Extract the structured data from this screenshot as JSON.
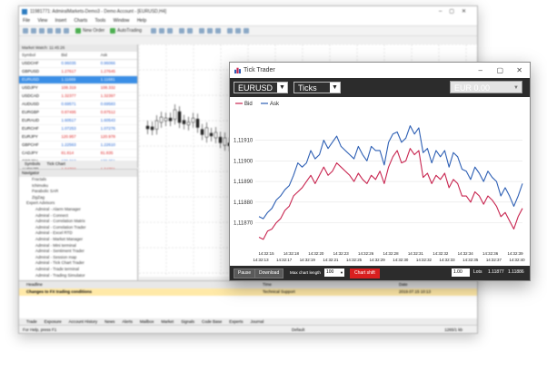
{
  "bg_window": {
    "title": "11981771: AdmiralMarkets-Demo3 - Demo Account - [EURUSD,H4]",
    "menu": [
      "File",
      "View",
      "Insert",
      "Charts",
      "Tools",
      "Window",
      "Help"
    ],
    "toolbar": {
      "new_order": "New Order",
      "auto_trading": "AutoTrading"
    },
    "market_watch": {
      "header": "Market Watch: 11:45:26",
      "columns": [
        "Symbol",
        "Bid",
        "Ask"
      ],
      "rows": [
        {
          "symbol": "USDCHF",
          "bid": "0.96035",
          "ask": "0.96066",
          "dir": "up"
        },
        {
          "symbol": "GBPUSD",
          "bid": "1.27617",
          "ask": "1.27645",
          "dir": "dn"
        },
        {
          "symbol": "EURUSD",
          "bid": "1.11669",
          "ask": "1.11681",
          "dir": "sel"
        },
        {
          "symbol": "USDJPY",
          "bid": "108.319",
          "ask": "108.332",
          "dir": "dn"
        },
        {
          "symbol": "USDCAD",
          "bid": "1.32377",
          "ask": "1.32397",
          "dir": "dn"
        },
        {
          "symbol": "AUDUSD",
          "bid": "0.69571",
          "ask": "0.69583",
          "dir": "up"
        },
        {
          "symbol": "EURGBP",
          "bid": "0.87495",
          "ask": "0.87512",
          "dir": "dn"
        },
        {
          "symbol": "EURAUD",
          "bid": "1.60517",
          "ask": "1.60543",
          "dir": "up"
        },
        {
          "symbol": "EURCHF",
          "bid": "1.07253",
          "ask": "1.07276",
          "dir": "up"
        },
        {
          "symbol": "EURJPY",
          "bid": "120.957",
          "ask": "120.978",
          "dir": "dn"
        },
        {
          "symbol": "GBPCHF",
          "bid": "1.22563",
          "ask": "1.22610",
          "dir": "up"
        },
        {
          "symbol": "CADJPY",
          "bid": "81.814",
          "ask": "81.835",
          "dir": "dn"
        },
        {
          "symbol": "GBPJPY",
          "bid": "138.213",
          "ask": "138.251",
          "dir": "up"
        },
        {
          "symbol": "AUDNZD",
          "bid": "1.04722",
          "ask": "1.04761",
          "dir": "dn"
        }
      ],
      "tabs": [
        "Symbols",
        "Tick Chart"
      ]
    },
    "navigator": {
      "header": "Navigator",
      "items": [
        "Fractals",
        "Ichimoku",
        "Parabolic SAR",
        "ZigZag",
        "Expert Advisors",
        "Admiral - Alarm Manager",
        "Admiral - Connect",
        "Admiral - Correlation Matrix",
        "Admiral - Correlation Trader",
        "Admiral - Excel RTD",
        "Admiral - Market Manager",
        "Admiral - Mini terminal",
        "Admiral - Sentiment Trader",
        "Admiral - Session map",
        "Admiral - Tick Chart Trader",
        "Admiral - Trade terminal",
        "Admiral - Trading Simulator"
      ],
      "tabs": [
        "Common",
        "Favorites"
      ]
    },
    "chart_tabs": [
      "EURUSD,H4",
      "GBPUSD,H4",
      "USDJPY,H4"
    ],
    "terminal": {
      "columns": [
        "Headline",
        "Time",
        "Date"
      ],
      "rows": [
        {
          "text": "Changes to FX trading conditions",
          "source": "Technical Support",
          "date": "2019.07.15 10:13"
        },
        {
          "text": "",
          "source": "",
          "date": ""
        }
      ],
      "tabs": [
        "Trade",
        "Exposure",
        "Account History",
        "News",
        "Alerts",
        "Mailbox",
        "Market",
        "Signals",
        "Code Base",
        "Experts",
        "Journal"
      ]
    },
    "status": {
      "left": "For Help, press F1",
      "middle": "Default",
      "right": "1265/1 kb"
    }
  },
  "tick_trader": {
    "title": "Tick Trader",
    "symbol": "EURUSD",
    "mode": "Ticks",
    "account": "EUR 0.00",
    "legend": [
      {
        "name": "Bid",
        "color": "#c8244f"
      },
      {
        "name": "Ask",
        "color": "#2d5fb4"
      }
    ],
    "footer": {
      "pause": "Pause",
      "download": "Download",
      "max_len_label": "Max chart length",
      "max_len_value": "100",
      "chart_shift": "Chart shift",
      "lots_value": "1.00",
      "lots_label": "Lots",
      "bid": "1.11877",
      "ask": "1.11886"
    }
  },
  "chart_data": {
    "type": "line",
    "title": "",
    "xlabel": "",
    "ylabel": "",
    "ylim": [
      1.11865,
      1.11923
    ],
    "y_ticks": [
      "1,11870",
      "1,11880",
      "1,11890",
      "1,11900",
      "1,11910"
    ],
    "y_tick_values": [
      1.1187,
      1.1188,
      1.1189,
      1.119,
      1.1191
    ],
    "x_ticks_row1": [
      "14:32:15",
      "14:32:18",
      "14:32:20",
      "14:32:23",
      "14:32:26",
      "14:32:28",
      "14:32:31",
      "14:32:32",
      "14:32:34",
      "14:32:36",
      "14:32:39"
    ],
    "x_ticks_row2": [
      "14:32:13",
      "14:32:17",
      "14:32:19",
      "14:32:21",
      "14:32:25",
      "14:32:29",
      "14:32:30",
      "14:32:32",
      "14:32:33",
      "14:32:35",
      "14:32:37",
      "14:32:40"
    ],
    "grid": true,
    "legend_position": "top-left",
    "series": [
      {
        "name": "Ask",
        "color": "#2d5fb4",
        "values": [
          1.11873,
          1.11872,
          1.11875,
          1.11877,
          1.11881,
          1.11883,
          1.11886,
          1.11888,
          1.11893,
          1.11899,
          1.11897,
          1.11899,
          1.11905,
          1.11901,
          1.11903,
          1.1191,
          1.11906,
          1.11909,
          1.11912,
          1.11907,
          1.11905,
          1.11903,
          1.11901,
          1.11907,
          1.11903,
          1.119,
          1.11907,
          1.11905,
          1.11905,
          1.11898,
          1.11909,
          1.11913,
          1.11914,
          1.11909,
          1.11911,
          1.11917,
          1.11913,
          1.11916,
          1.11904,
          1.11906,
          1.11899,
          1.11905,
          1.11902,
          1.11905,
          1.11897,
          1.11904,
          1.11902,
          1.11896,
          1.11895,
          1.11891,
          1.11897,
          1.11894,
          1.1189,
          1.11895,
          1.11892,
          1.1189,
          1.11883,
          1.11887,
          1.11883,
          1.11878,
          1.11883,
          1.11889
        ]
      },
      {
        "name": "Bid",
        "color": "#c8244f",
        "values": [
          1.11863,
          1.11862,
          1.11866,
          1.11867,
          1.1187,
          1.11872,
          1.11876,
          1.11878,
          1.11883,
          1.11885,
          1.11887,
          1.1189,
          1.11893,
          1.11889,
          1.11893,
          1.11897,
          1.11893,
          1.11895,
          1.11899,
          1.11897,
          1.11895,
          1.11893,
          1.1189,
          1.11894,
          1.11891,
          1.11889,
          1.11893,
          1.11891,
          1.11895,
          1.11889,
          1.11897,
          1.11902,
          1.11905,
          1.11899,
          1.119,
          1.11906,
          1.11903,
          1.11905,
          1.11892,
          1.11894,
          1.11889,
          1.11893,
          1.11891,
          1.11894,
          1.11887,
          1.11891,
          1.11889,
          1.11883,
          1.11883,
          1.1188,
          1.11885,
          1.11883,
          1.11879,
          1.11883,
          1.11881,
          1.11878,
          1.11873,
          1.11875,
          1.11871,
          1.11867,
          1.11873,
          1.11877
        ]
      }
    ]
  }
}
